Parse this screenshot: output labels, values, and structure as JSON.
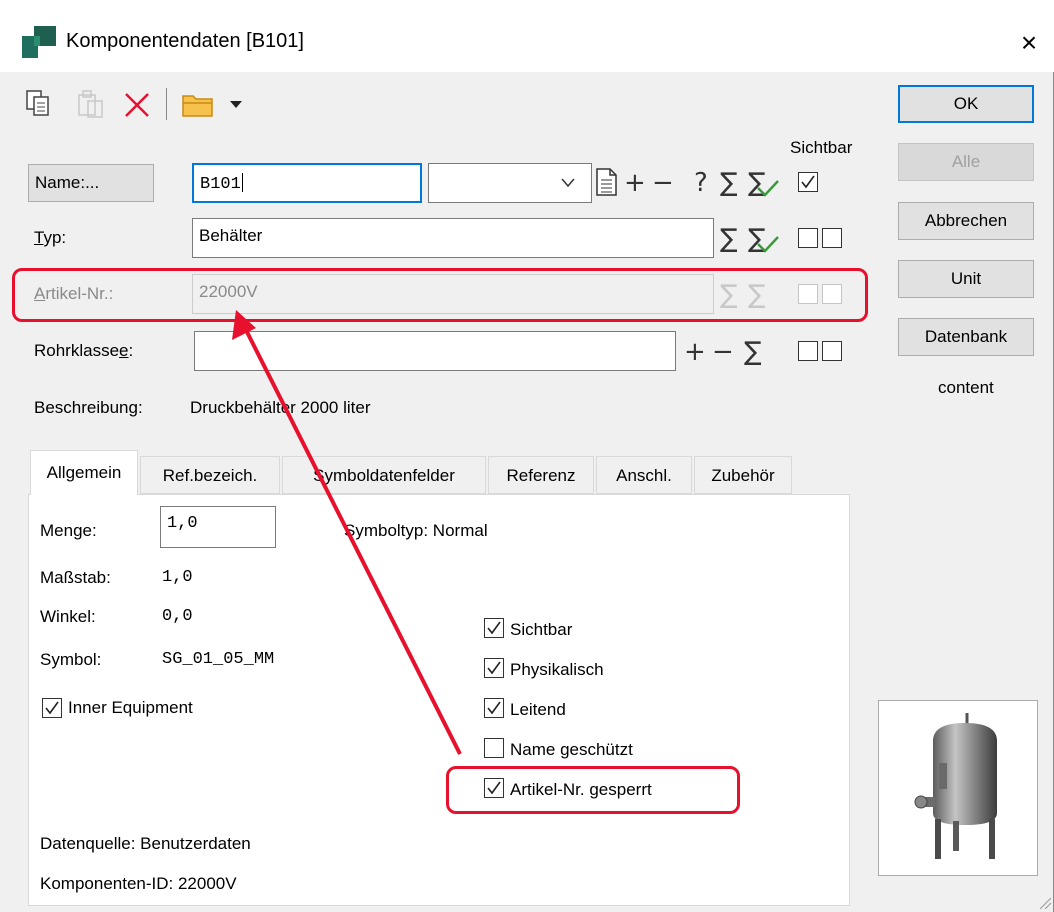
{
  "window": {
    "title": "Komponentendaten [B101]",
    "close_glyph": "×",
    "icon": "app-icon"
  },
  "toolbar": {
    "icons": [
      "copy-icon",
      "paste-icon",
      "delete-icon",
      "folder-icon",
      "chevron-down-icon"
    ]
  },
  "side_buttons": {
    "ok": "OK",
    "alle": "Alle",
    "abbrechen": "Abbrechen",
    "unit": "Unit",
    "datenbank": "Datenbank",
    "content": "content"
  },
  "header": {
    "sichtbar_label": "Sichtbar"
  },
  "form": {
    "name_button": "Name:...",
    "name_value": "B101",
    "name_dropdown_value": "",
    "typ_label_u": "T",
    "typ_label_rest": "yp:",
    "typ_value": "Behälter",
    "artikel_label_u": "A",
    "artikel_label_rest": "rtikel-Nr.:",
    "artikel_value": "22000V",
    "rohrklasse_label_main": "Rohrklasse",
    "rohrklasse_label_u": "e",
    "rohrklasse_label_end": ":",
    "rohrklasse_value": "",
    "beschreibung_label": "Beschreibung:",
    "beschreibung_value": "Druckbehälter 2000 liter"
  },
  "symbols": {
    "doc": "🗎",
    "plus": "+",
    "minus": "−",
    "question": "?",
    "sigma": "∑"
  },
  "tabs": [
    "Allgemein",
    "Ref.bezeich.",
    "Symboldatenfelder",
    "Referenz",
    "Anschl.",
    "Zubehör"
  ],
  "general": {
    "menge_label": "Menge:",
    "menge_value": "1,0",
    "symboltyp": "Symboltyp: Normal",
    "massstab_label": "Maßstab:",
    "massstab_value": "1,0",
    "winkel_label": "Winkel:",
    "winkel_value": "0,0",
    "symbol_label": "Symbol:",
    "symbol_value": "SG_01_05_MM",
    "inner_equipment": "Inner Equipment",
    "datenquelle": "Datenquelle: Benutzerdaten",
    "komponenten_id": "Komponenten-ID: 22000V"
  },
  "checkboxes": [
    {
      "label": "Sichtbar",
      "checked": true
    },
    {
      "label": "Physikalisch",
      "checked": true
    },
    {
      "label": "Leitend",
      "checked": true
    },
    {
      "label": "Name geschützt",
      "checked": false
    },
    {
      "label": "Artikel-Nr. gesperrt",
      "checked": true
    }
  ],
  "colors": {
    "accent": "#0078d7",
    "annotation_red": "#e8112d"
  }
}
